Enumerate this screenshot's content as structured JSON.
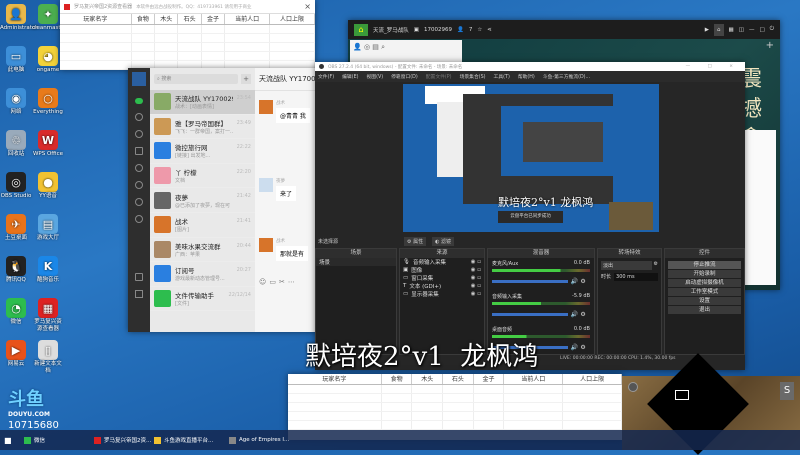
{
  "desktop_icons": [
    {
      "label": "Administrator",
      "color": "#e8b84a",
      "glyph": "👤"
    },
    {
      "label": "cleanmaster",
      "color": "#4caf50",
      "glyph": "✦"
    },
    {
      "label": "此电脑",
      "color": "#3d8fd8",
      "glyph": "▭"
    },
    {
      "label": "ongame",
      "color": "#f3d23a",
      "glyph": "◕"
    },
    {
      "label": "网络",
      "color": "#3d8fd8",
      "glyph": "◉"
    },
    {
      "label": "Everything",
      "color": "#e87a1a",
      "glyph": "○"
    },
    {
      "label": "回收站",
      "color": "#9ab",
      "glyph": "♲"
    },
    {
      "label": "WPS Office",
      "color": "#d92b2b",
      "glyph": "W"
    },
    {
      "label": "OBS Studio",
      "color": "#222",
      "glyph": "◎"
    },
    {
      "label": "YY语音",
      "color": "#f1c232",
      "glyph": "●"
    },
    {
      "label": "土豆桌面",
      "color": "#e8731a",
      "glyph": "✈"
    },
    {
      "label": "游戏大厅",
      "color": "#5aa6e0",
      "glyph": "▤"
    },
    {
      "label": "腾讯QQ",
      "color": "#222",
      "glyph": "🐧"
    },
    {
      "label": "酷狗音乐",
      "color": "#1a87e8",
      "glyph": "K"
    },
    {
      "label": "微信",
      "color": "#2dbd4e",
      "glyph": "◔"
    },
    {
      "label": "罗马复兴资源查看器",
      "color": "#d22",
      "glyph": "▦"
    },
    {
      "label": "网易云",
      "color": "#e8521a",
      "glyph": "▶"
    },
    {
      "label": "新建文本文档",
      "color": "#ddd",
      "glyph": "▯"
    }
  ],
  "resource_window": {
    "title": "罗马复兴帝国2资源查看器",
    "subtitle": "本软件由远古战役制作。QQ：419733961 请勿用于商业",
    "close": "×",
    "columns": [
      "玩家名字",
      "食物",
      "木头",
      "石头",
      "金子",
      "当前人口",
      "人口上限"
    ]
  },
  "wechat": {
    "search_placeholder": "搜索",
    "add": "+",
    "chat_title": "天流战队 YY17002969",
    "chats": [
      {
        "name": "天流战队 YY17002969",
        "preview": "战术：[动画表情]",
        "time": "23:54",
        "color": "#8a6"
      },
      {
        "name": "雅【罗马帝国群】",
        "preview": "飞飞：一群帝国，案打一...",
        "time": "23:49",
        "color": "#c95"
      },
      {
        "name": "微控旅行网",
        "preview": "[链接] 出发地...",
        "time": "22:22",
        "color": "#2a7fe0"
      },
      {
        "name": "丫 柠檬",
        "preview": "文档",
        "time": "22:20",
        "color": "#e9a"
      },
      {
        "name": "夜夢",
        "preview": "@已添加了夜夢，现在可",
        "time": "21:42",
        "color": "#666"
      },
      {
        "name": "战术",
        "preview": "[图片]",
        "time": "21:41",
        "color": "#d7742a"
      },
      {
        "name": "美味水果交流群",
        "preview": "广西：苹果",
        "time": "20:44",
        "color": "#a86"
      },
      {
        "name": "订阅号",
        "preview": "游戏最新动态管理号...",
        "time": "20:27",
        "color": "#2a7fe0"
      },
      {
        "name": "文件传输助手",
        "preview": "[文件]",
        "time": "22/12/14",
        "color": "#2dbd4e"
      }
    ],
    "messages": [
      {
        "sender": "战术",
        "text": "@青青 我"
      },
      {
        "sender": "夜夢",
        "text": "来了"
      },
      {
        "sender": "战术",
        "text": "那就是有"
      }
    ]
  },
  "yy": {
    "channel": "天流_罗马战队",
    "id": "17002969",
    "members": "7",
    "banner_chars": "震撼 拿",
    "add": "+"
  },
  "obs": {
    "title": "OBS 27.2.4 (64 bit, windows) - 配置文件: 未命名 - 场景: 未命名",
    "menu": [
      "文件(F)",
      "编辑(E)",
      "视图(V)",
      "停靠窗口(D)",
      "配置文件(P)",
      "场景集合(S)",
      "工具(T)",
      "帮助(H)",
      "斗鱼-第三方推流(D)..."
    ],
    "no_source": "未选择源",
    "props_btn": "属性",
    "filters_btn": "滤镜",
    "docks": {
      "scenes": "场景",
      "sources": "来源",
      "mixer": "混音器",
      "transitions": "转场特效",
      "controls": "控件"
    },
    "scenes": [
      "场景"
    ],
    "sources": [
      "音频输入采集",
      "图像",
      "窗口采集",
      "文本 (GDI+)",
      "显示器采集"
    ],
    "mixer": [
      {
        "name": "麦克风/Aux",
        "db": "0.0 dB",
        "level": 0.7
      },
      {
        "name": "音频输入采集",
        "db": "-5.9 dB",
        "level": 0.5
      },
      {
        "name": "桌面音频",
        "db": "0.0 dB",
        "level": 0.35
      }
    ],
    "transition": {
      "type": "淡出",
      "duration_label": "时长",
      "duration": "300 ms"
    },
    "controls": [
      "停止推流",
      "开始录制",
      "启动虚拟摄像机",
      "工作室模式",
      "设置",
      "退出"
    ],
    "status": "LIVE: 00:00:00  REC: 00:00:00  CPU: 1.4%, 30.00 fps",
    "preview_caption": "默培夜2°v1 龙枫鸿",
    "preview_popup": "云盘平台已同步成功"
  },
  "overlay_text": "默培夜2°v1  龙枫鸿",
  "douyu": {
    "logo": "斗鱼",
    "domain": "DOUYU.COM",
    "room": "10715680"
  },
  "game": {
    "hotkey": "S"
  },
  "taskbar": [
    {
      "label": "微信",
      "color": "#2dbd4e"
    },
    {
      "label": "罗马复兴帝国2资...",
      "color": "#d22"
    },
    {
      "label": "斗鱼游戏直播平台...",
      "color": "#f1c232"
    },
    {
      "label": "Age of Empires I...",
      "color": "#888"
    }
  ]
}
